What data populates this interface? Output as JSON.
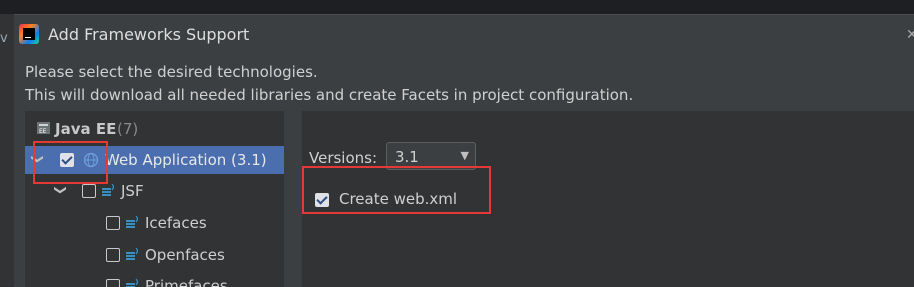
{
  "background": {
    "edge_text": "v"
  },
  "dialog": {
    "title": "Add Frameworks Support",
    "description_line1": "Please select the desired technologies.",
    "description_line2": "This will download all needed libraries and create Facets in project configuration."
  },
  "tree": {
    "group": {
      "label": "Java EE",
      "count": "(7)"
    },
    "items": [
      {
        "label": "Web Application (3.1)",
        "checked": true,
        "expanded": true,
        "selected": true
      },
      {
        "label": "JSF",
        "checked": false,
        "expanded": true
      },
      {
        "label": "Icefaces",
        "checked": false
      },
      {
        "label": "Openfaces",
        "checked": false
      },
      {
        "label": "Primefaces",
        "checked": false
      }
    ]
  },
  "settings": {
    "versions_label": "Versions:",
    "version_value": "3.1",
    "create_web_xml_label": "Create web.xml",
    "create_web_xml_checked": true
  },
  "colors": {
    "accent_selection": "#4b6eaf",
    "highlight_box": "#e53935"
  }
}
